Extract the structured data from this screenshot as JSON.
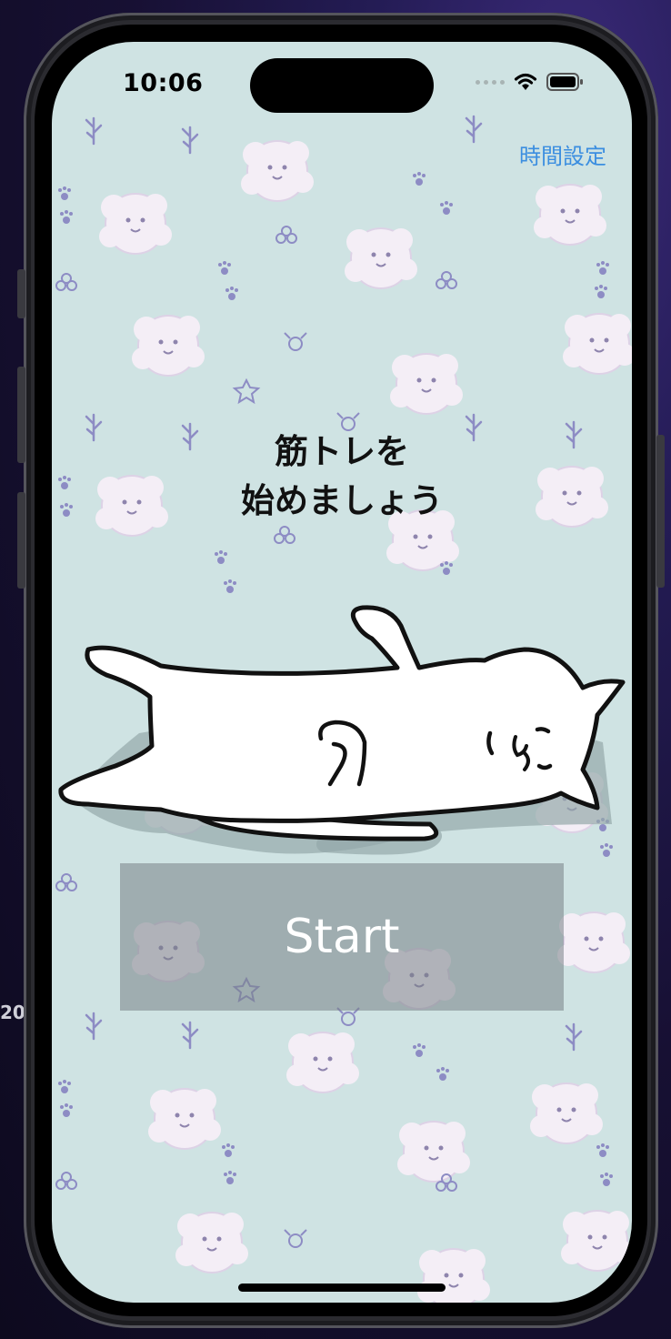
{
  "stray_text": "20",
  "status_bar": {
    "time": "10:06",
    "wifi_icon": "wifi-icon",
    "battery_icon": "battery-icon"
  },
  "nav": {
    "time_setting_label": "時間設定"
  },
  "main": {
    "headline_line1": "筋トレを",
    "headline_line2": "始めましょう",
    "illustration": "lying-cat-illustration",
    "start_label": "Start"
  },
  "colors": {
    "background": "#cfe3e3",
    "link": "#3b8ee0",
    "button": "#8a9497"
  }
}
